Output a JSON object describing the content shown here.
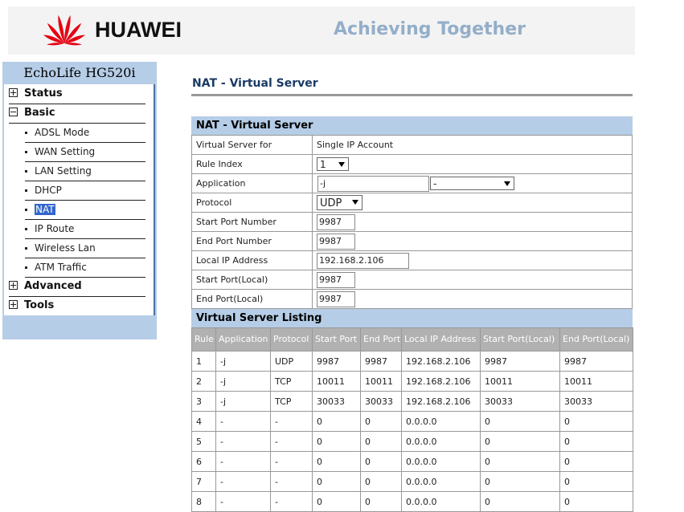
{
  "header": {
    "brand": "HUAWEI",
    "slogan": "Achieving Together"
  },
  "sidebar": {
    "title": "EchoLife HG520i",
    "items": [
      {
        "label": "Status",
        "level": "top",
        "expander": "plus"
      },
      {
        "label": "Basic",
        "level": "top",
        "expander": "minus"
      },
      {
        "label": "ADSL Mode",
        "level": "sub"
      },
      {
        "label": "WAN Setting",
        "level": "sub"
      },
      {
        "label": "LAN Setting",
        "level": "sub"
      },
      {
        "label": "DHCP",
        "level": "sub"
      },
      {
        "label": "NAT",
        "level": "sub",
        "active": true
      },
      {
        "label": "IP Route",
        "level": "sub"
      },
      {
        "label": "Wireless Lan",
        "level": "sub"
      },
      {
        "label": "ATM Traffic",
        "level": "sub"
      },
      {
        "label": "Advanced",
        "level": "top",
        "expander": "plus"
      },
      {
        "label": "Tools",
        "level": "top",
        "expander": "plus"
      }
    ]
  },
  "page_title": "NAT - Virtual Server",
  "form": {
    "section_title": "NAT - Virtual Server",
    "virtual_server_for_label": "Virtual Server for",
    "virtual_server_for_value": "Single IP Account",
    "rule_index_label": "Rule Index",
    "rule_index_value": "1",
    "application_label": "Application",
    "application_value": "-j",
    "application_select_value": "-",
    "protocol_label": "Protocol",
    "protocol_value": "UDP",
    "start_port_label": "Start Port Number",
    "start_port_value": "9987",
    "end_port_label": "End Port Number",
    "end_port_value": "9987",
    "local_ip_label": "Local IP Address",
    "local_ip_value": "192.168.2.106",
    "start_port_local_label": "Start Port(Local)",
    "start_port_local_value": "9987",
    "end_port_local_label": "End Port(Local)",
    "end_port_local_value": "9987"
  },
  "listing": {
    "section_title": "Virtual Server Listing",
    "columns": [
      "Rule",
      "Application",
      "Protocol",
      "Start Port",
      "End Port",
      "Local IP Address",
      "Start Port(Local)",
      "End Port(Local)"
    ],
    "rows": [
      [
        "1",
        "-j",
        "UDP",
        "9987",
        "9987",
        "192.168.2.106",
        "9987",
        "9987"
      ],
      [
        "2",
        "-j",
        "TCP",
        "10011",
        "10011",
        "192.168.2.106",
        "10011",
        "10011"
      ],
      [
        "3",
        "-j",
        "TCP",
        "30033",
        "30033",
        "192.168.2.106",
        "30033",
        "30033"
      ],
      [
        "4",
        "-",
        "-",
        "0",
        "0",
        "0.0.0.0",
        "0",
        "0"
      ],
      [
        "5",
        "-",
        "-",
        "0",
        "0",
        "0.0.0.0",
        "0",
        "0"
      ],
      [
        "6",
        "-",
        "-",
        "0",
        "0",
        "0.0.0.0",
        "0",
        "0"
      ],
      [
        "7",
        "-",
        "-",
        "0",
        "0",
        "0.0.0.0",
        "0",
        "0"
      ],
      [
        "8",
        "-",
        "-",
        "0",
        "0",
        "0.0.0.0",
        "0",
        "0"
      ]
    ]
  },
  "icons": {
    "logo": "huawei-logo-icon",
    "expand": "plus-box-icon",
    "collapse": "minus-box-icon",
    "dropdown": "chevron-down-icon"
  },
  "colors": {
    "logo_red": "#e60012",
    "sidebar_bg": "#b6cde7",
    "section_bg": "#b6cde7",
    "table_header_bg": "#b1b1b1",
    "slogan": "#93aec9",
    "title": "#1a3a66",
    "active_item": "#3366cc"
  }
}
